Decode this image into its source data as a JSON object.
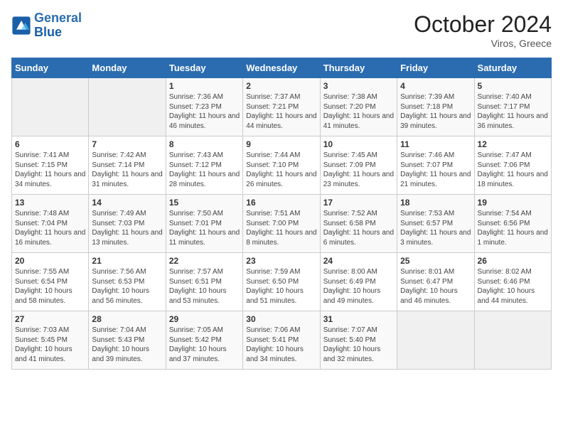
{
  "header": {
    "logo_general": "General",
    "logo_blue": "Blue",
    "month_title": "October 2024",
    "location": "Viros, Greece"
  },
  "days_of_week": [
    "Sunday",
    "Monday",
    "Tuesday",
    "Wednesday",
    "Thursday",
    "Friday",
    "Saturday"
  ],
  "weeks": [
    [
      {
        "day": "",
        "sunrise": "",
        "sunset": "",
        "daylight": "",
        "empty": true
      },
      {
        "day": "",
        "sunrise": "",
        "sunset": "",
        "daylight": "",
        "empty": true
      },
      {
        "day": "1",
        "sunrise": "Sunrise: 7:36 AM",
        "sunset": "Sunset: 7:23 PM",
        "daylight": "Daylight: 11 hours and 46 minutes.",
        "empty": false
      },
      {
        "day": "2",
        "sunrise": "Sunrise: 7:37 AM",
        "sunset": "Sunset: 7:21 PM",
        "daylight": "Daylight: 11 hours and 44 minutes.",
        "empty": false
      },
      {
        "day": "3",
        "sunrise": "Sunrise: 7:38 AM",
        "sunset": "Sunset: 7:20 PM",
        "daylight": "Daylight: 11 hours and 41 minutes.",
        "empty": false
      },
      {
        "day": "4",
        "sunrise": "Sunrise: 7:39 AM",
        "sunset": "Sunset: 7:18 PM",
        "daylight": "Daylight: 11 hours and 39 minutes.",
        "empty": false
      },
      {
        "day": "5",
        "sunrise": "Sunrise: 7:40 AM",
        "sunset": "Sunset: 7:17 PM",
        "daylight": "Daylight: 11 hours and 36 minutes.",
        "empty": false
      }
    ],
    [
      {
        "day": "6",
        "sunrise": "Sunrise: 7:41 AM",
        "sunset": "Sunset: 7:15 PM",
        "daylight": "Daylight: 11 hours and 34 minutes.",
        "empty": false
      },
      {
        "day": "7",
        "sunrise": "Sunrise: 7:42 AM",
        "sunset": "Sunset: 7:14 PM",
        "daylight": "Daylight: 11 hours and 31 minutes.",
        "empty": false
      },
      {
        "day": "8",
        "sunrise": "Sunrise: 7:43 AM",
        "sunset": "Sunset: 7:12 PM",
        "daylight": "Daylight: 11 hours and 28 minutes.",
        "empty": false
      },
      {
        "day": "9",
        "sunrise": "Sunrise: 7:44 AM",
        "sunset": "Sunset: 7:10 PM",
        "daylight": "Daylight: 11 hours and 26 minutes.",
        "empty": false
      },
      {
        "day": "10",
        "sunrise": "Sunrise: 7:45 AM",
        "sunset": "Sunset: 7:09 PM",
        "daylight": "Daylight: 11 hours and 23 minutes.",
        "empty": false
      },
      {
        "day": "11",
        "sunrise": "Sunrise: 7:46 AM",
        "sunset": "Sunset: 7:07 PM",
        "daylight": "Daylight: 11 hours and 21 minutes.",
        "empty": false
      },
      {
        "day": "12",
        "sunrise": "Sunrise: 7:47 AM",
        "sunset": "Sunset: 7:06 PM",
        "daylight": "Daylight: 11 hours and 18 minutes.",
        "empty": false
      }
    ],
    [
      {
        "day": "13",
        "sunrise": "Sunrise: 7:48 AM",
        "sunset": "Sunset: 7:04 PM",
        "daylight": "Daylight: 11 hours and 16 minutes.",
        "empty": false
      },
      {
        "day": "14",
        "sunrise": "Sunrise: 7:49 AM",
        "sunset": "Sunset: 7:03 PM",
        "daylight": "Daylight: 11 hours and 13 minutes.",
        "empty": false
      },
      {
        "day": "15",
        "sunrise": "Sunrise: 7:50 AM",
        "sunset": "Sunset: 7:01 PM",
        "daylight": "Daylight: 11 hours and 11 minutes.",
        "empty": false
      },
      {
        "day": "16",
        "sunrise": "Sunrise: 7:51 AM",
        "sunset": "Sunset: 7:00 PM",
        "daylight": "Daylight: 11 hours and 8 minutes.",
        "empty": false
      },
      {
        "day": "17",
        "sunrise": "Sunrise: 7:52 AM",
        "sunset": "Sunset: 6:58 PM",
        "daylight": "Daylight: 11 hours and 6 minutes.",
        "empty": false
      },
      {
        "day": "18",
        "sunrise": "Sunrise: 7:53 AM",
        "sunset": "Sunset: 6:57 PM",
        "daylight": "Daylight: 11 hours and 3 minutes.",
        "empty": false
      },
      {
        "day": "19",
        "sunrise": "Sunrise: 7:54 AM",
        "sunset": "Sunset: 6:56 PM",
        "daylight": "Daylight: 11 hours and 1 minute.",
        "empty": false
      }
    ],
    [
      {
        "day": "20",
        "sunrise": "Sunrise: 7:55 AM",
        "sunset": "Sunset: 6:54 PM",
        "daylight": "Daylight: 10 hours and 58 minutes.",
        "empty": false
      },
      {
        "day": "21",
        "sunrise": "Sunrise: 7:56 AM",
        "sunset": "Sunset: 6:53 PM",
        "daylight": "Daylight: 10 hours and 56 minutes.",
        "empty": false
      },
      {
        "day": "22",
        "sunrise": "Sunrise: 7:57 AM",
        "sunset": "Sunset: 6:51 PM",
        "daylight": "Daylight: 10 hours and 53 minutes.",
        "empty": false
      },
      {
        "day": "23",
        "sunrise": "Sunrise: 7:59 AM",
        "sunset": "Sunset: 6:50 PM",
        "daylight": "Daylight: 10 hours and 51 minutes.",
        "empty": false
      },
      {
        "day": "24",
        "sunrise": "Sunrise: 8:00 AM",
        "sunset": "Sunset: 6:49 PM",
        "daylight": "Daylight: 10 hours and 49 minutes.",
        "empty": false
      },
      {
        "day": "25",
        "sunrise": "Sunrise: 8:01 AM",
        "sunset": "Sunset: 6:47 PM",
        "daylight": "Daylight: 10 hours and 46 minutes.",
        "empty": false
      },
      {
        "day": "26",
        "sunrise": "Sunrise: 8:02 AM",
        "sunset": "Sunset: 6:46 PM",
        "daylight": "Daylight: 10 hours and 44 minutes.",
        "empty": false
      }
    ],
    [
      {
        "day": "27",
        "sunrise": "Sunrise: 7:03 AM",
        "sunset": "Sunset: 5:45 PM",
        "daylight": "Daylight: 10 hours and 41 minutes.",
        "empty": false
      },
      {
        "day": "28",
        "sunrise": "Sunrise: 7:04 AM",
        "sunset": "Sunset: 5:43 PM",
        "daylight": "Daylight: 10 hours and 39 minutes.",
        "empty": false
      },
      {
        "day": "29",
        "sunrise": "Sunrise: 7:05 AM",
        "sunset": "Sunset: 5:42 PM",
        "daylight": "Daylight: 10 hours and 37 minutes.",
        "empty": false
      },
      {
        "day": "30",
        "sunrise": "Sunrise: 7:06 AM",
        "sunset": "Sunset: 5:41 PM",
        "daylight": "Daylight: 10 hours and 34 minutes.",
        "empty": false
      },
      {
        "day": "31",
        "sunrise": "Sunrise: 7:07 AM",
        "sunset": "Sunset: 5:40 PM",
        "daylight": "Daylight: 10 hours and 32 minutes.",
        "empty": false
      },
      {
        "day": "",
        "sunrise": "",
        "sunset": "",
        "daylight": "",
        "empty": true
      },
      {
        "day": "",
        "sunrise": "",
        "sunset": "",
        "daylight": "",
        "empty": true
      }
    ]
  ]
}
